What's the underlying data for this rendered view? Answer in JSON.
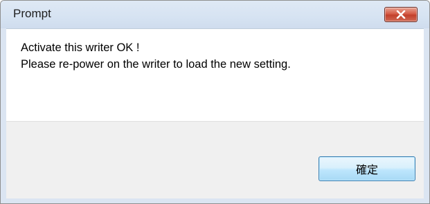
{
  "window": {
    "title": "Prompt",
    "close_icon": "close-icon"
  },
  "message": {
    "line1": "Activate this writer OK !",
    "line2": "Please re-power on the writer to load the new setting."
  },
  "buttons": {
    "ok_label": "確定"
  },
  "colors": {
    "close_button": "#c9432f",
    "title_bar": "#d6e3f2",
    "ok_button_border": "#3c7fb1"
  }
}
